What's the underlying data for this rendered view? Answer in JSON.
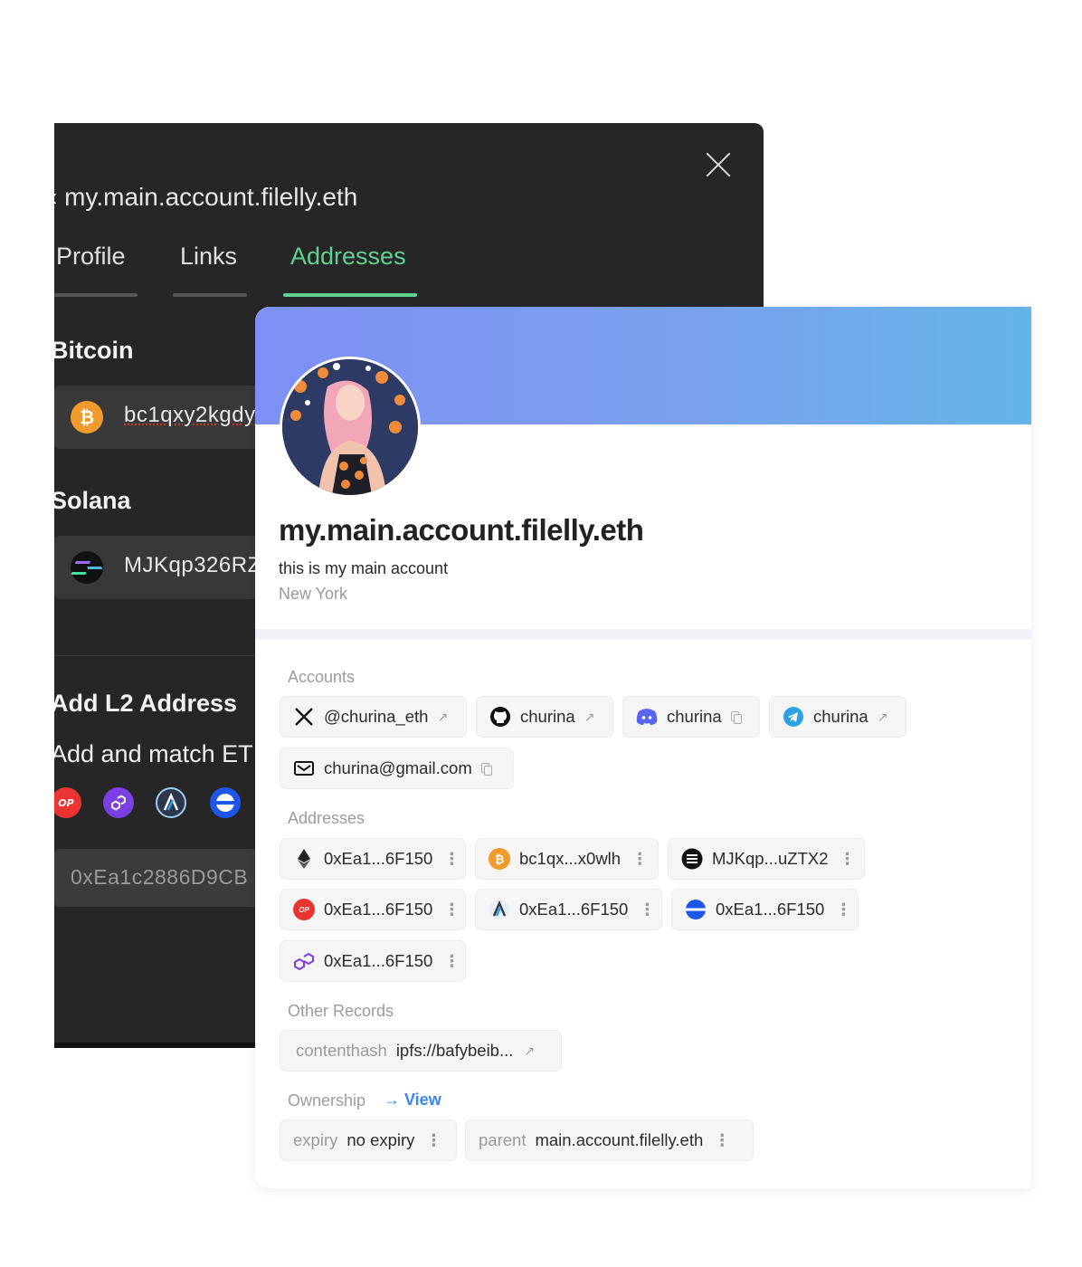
{
  "editor": {
    "title": "my.main.account.filelly.eth",
    "back_glyph": "‹",
    "tabs": [
      "Profile",
      "Links",
      "Addresses"
    ],
    "active_tab": "Addresses",
    "bitcoin_label": "Bitcoin",
    "bitcoin_value": "bc1qxy2kgdy",
    "solana_label": "Solana",
    "solana_value": "MJKqp326RZ",
    "l2_title": "Add L2 Address",
    "l2_subtitle": "Add and match ET",
    "l2_address": "0xEa1c2886D9CB"
  },
  "profile": {
    "name": "my.main.account.filelly.eth",
    "bio": "this is my main account",
    "location": "New York",
    "accounts_label": "Accounts",
    "accounts": [
      {
        "icon": "x-icon",
        "text": "@churina_eth",
        "action": "↗"
      },
      {
        "icon": "github-icon",
        "text": "churina",
        "action": "↗"
      },
      {
        "icon": "discord-icon",
        "text": "churina",
        "action": "copy"
      },
      {
        "icon": "telegram-icon",
        "text": "churina",
        "action": "↗"
      },
      {
        "icon": "mail-icon",
        "text": "churina@gmail.com",
        "action": "copy"
      }
    ],
    "addresses_label": "Addresses",
    "addresses": [
      {
        "icon": "ethereum-icon",
        "text": "0xEa1...6F150"
      },
      {
        "icon": "bitcoin-icon",
        "text": "bc1qx...x0wlh"
      },
      {
        "icon": "solana-icon",
        "text": "MJKqp...uZTX2"
      },
      {
        "icon": "optimism-icon",
        "text": "0xEa1...6F150"
      },
      {
        "icon": "arbitrum-icon",
        "text": "0xEa1...6F150"
      },
      {
        "icon": "base-icon",
        "text": "0xEa1...6F150"
      },
      {
        "icon": "polygon-icon",
        "text": "0xEa1...6F150"
      }
    ],
    "other_label": "Other Records",
    "contenthash_key": "contenthash",
    "contenthash_value": "ipfs://bafybeib...",
    "ownership_label": "Ownership",
    "ownership_link": "→ View",
    "expiry_key": "expiry",
    "expiry_value": "no expiry",
    "parent_key": "parent",
    "parent_value": "main.account.filelly.eth"
  },
  "colors": {
    "editor_bg": "#262626",
    "active_tab": "#5fd291",
    "banner_start": "#7f8ff4",
    "banner_end": "#64b5e9",
    "link": "#3a84ea"
  }
}
